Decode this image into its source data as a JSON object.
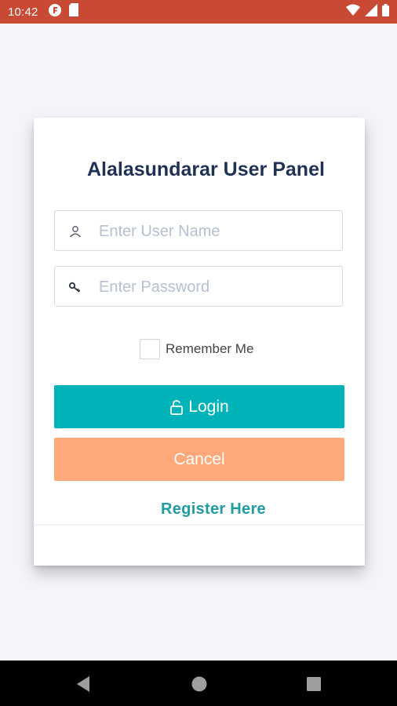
{
  "status_bar": {
    "time": "10:42",
    "icons_left": [
      "notification-f-icon",
      "sd-card-icon"
    ],
    "icons_right": [
      "wifi-icon",
      "signal-icon",
      "battery-icon"
    ]
  },
  "login": {
    "title": "Alalasundarar User Panel",
    "username": {
      "placeholder": "Enter User Name",
      "value": "",
      "icon": "user-icon"
    },
    "password": {
      "placeholder": "Enter Password",
      "value": "",
      "icon": "key-icon"
    },
    "remember_label": "Remember Me",
    "remember_checked": false,
    "login_label": "Login",
    "cancel_label": "Cancel",
    "register_label": "Register Here"
  },
  "colors": {
    "status_bar": "#c94a34",
    "title": "#1f3256",
    "login_button": "#00b3b8",
    "cancel_button": "#ffa87a",
    "register_link": "#1e9da2"
  },
  "nav_bar": {
    "icons": [
      "back-icon",
      "home-icon",
      "recents-icon"
    ]
  }
}
